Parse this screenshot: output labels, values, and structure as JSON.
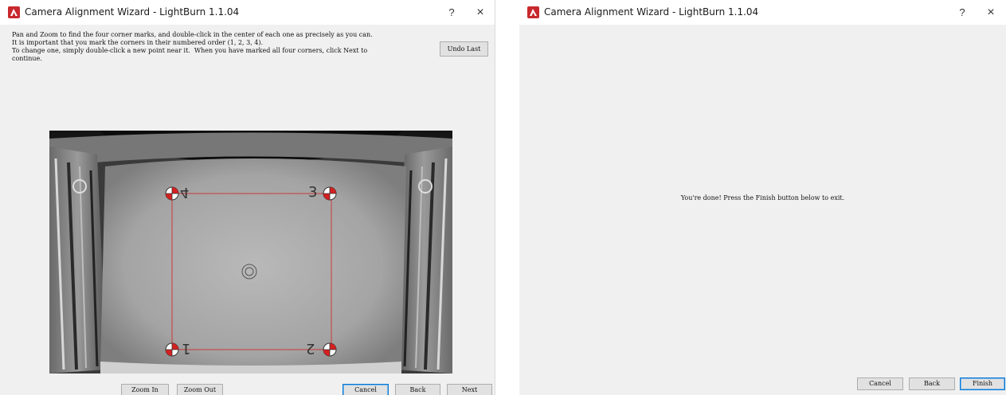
{
  "left_window": {
    "title": "Camera Alignment Wizard - LightBurn 1.1.04",
    "help": "?",
    "close": "×",
    "instructions": [
      "Pan and Zoom to find the four corner marks, and double-click in the center of each one as precisely as you can.",
      "It is important that you mark the corners in their numbered order (1, 2, 3, 4).",
      "To change one, simply double-click a new point near it.  When you have marked all four corners, click Next to",
      "continue."
    ],
    "undo_last": "Undo Last",
    "zoom_in": "Zoom In",
    "zoom_out": "Zoom Out",
    "cancel": "Cancel",
    "back": "Back",
    "next": "Next",
    "markers": {
      "m1": "1",
      "m2": "2",
      "m3": "3",
      "m4": "4"
    }
  },
  "right_window": {
    "title": "Camera Alignment Wizard - LightBurn 1.1.04",
    "help": "?",
    "close": "×",
    "message": "You're done!  Press the Finish button below to exit.",
    "cancel": "Cancel",
    "back": "Back",
    "finish": "Finish"
  },
  "colors": {
    "accent": "#0078d7",
    "marker_red": "#d42020",
    "app_icon_red": "#c8282d"
  }
}
